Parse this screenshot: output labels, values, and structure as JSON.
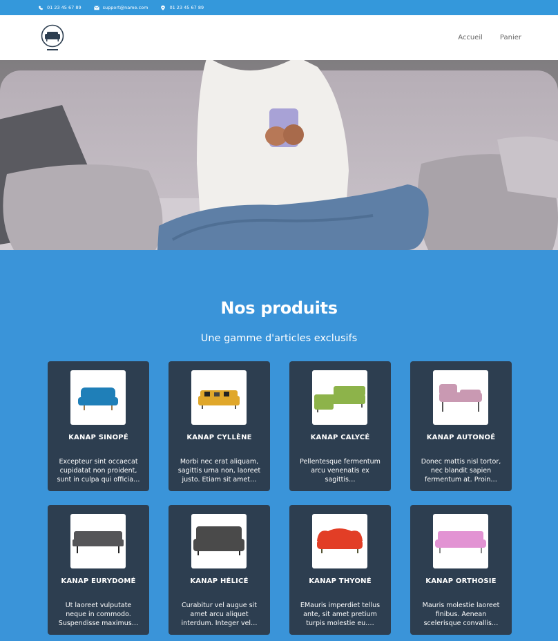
{
  "topbar": {
    "phone": "01 23 45 67 89",
    "email": "support@name.com",
    "address": "01 23 45 67 89"
  },
  "nav": {
    "links": [
      "Accueil",
      "Panier"
    ]
  },
  "section": {
    "title": "Nos produits",
    "subtitle": "Une gamme d'articles exclusifs"
  },
  "products": [
    {
      "name": "KANAP SINOPÉ",
      "desc": "Excepteur sint occaecat cupidatat non proident, sunt in culpa qui officia…",
      "color": "#1f7fb8"
    },
    {
      "name": "KANAP CYLLÈNE",
      "desc": "Morbi nec erat aliquam, sagittis urna non, laoreet justo. Etiam sit amet…",
      "color": "#e0a72a"
    },
    {
      "name": "KANAP CALYCÉ",
      "desc": "Pellentesque fermentum arcu venenatis ex sagittis…",
      "color": "#8db34a"
    },
    {
      "name": "KANAP AUTONOÉ",
      "desc": "Donec mattis nisl tortor, nec blandit sapien fermentum at. Proin…",
      "color": "#c999b2"
    },
    {
      "name": "KANAP EURYDOMÉ",
      "desc": "Ut laoreet vulputate neque in commodo. Suspendisse maximus…",
      "color": "#555558"
    },
    {
      "name": "KANAP HÉLICÉ",
      "desc": "Curabitur vel augue sit amet arcu aliquet interdum. Integer vel…",
      "color": "#4a4a4a"
    },
    {
      "name": "KANAP THYONÉ",
      "desc": "EMauris imperdiet tellus ante, sit amet pretium turpis molestie eu.…",
      "color": "#e23e26"
    },
    {
      "name": "KANAP ORTHOSIE",
      "desc": "Mauris molestie laoreet finibus. Aenean scelerisque convallis…",
      "color": "#e293d3"
    }
  ],
  "colors": {
    "accent": "#3498db",
    "section_bg": "#3a94d9",
    "card_bg": "#2d3e50"
  },
  "icons": {
    "phone": "phone-icon",
    "email": "envelope-icon",
    "address": "map-pin-icon",
    "logo": "kanap-logo"
  }
}
